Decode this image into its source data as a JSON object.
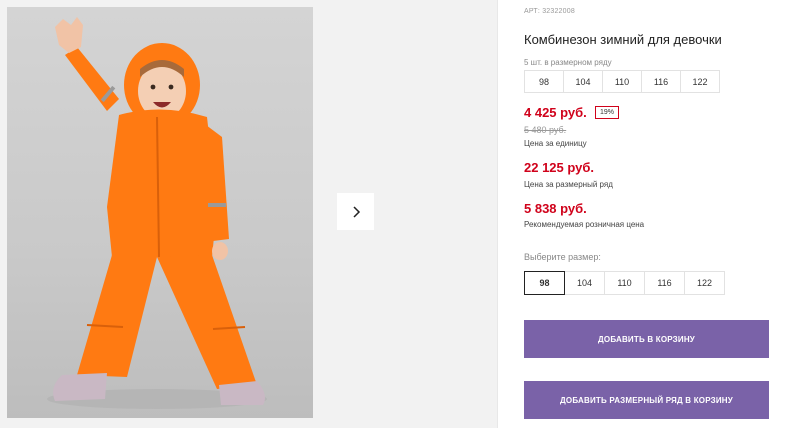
{
  "product": {
    "article": "АРТ: 32322008",
    "title": "Комбинезон зимний для девочки",
    "image_alt": "girl in orange winter jumpsuit"
  },
  "pack": {
    "label": "5 шт. в размерном ряду",
    "sizes": [
      "98",
      "104",
      "110",
      "116",
      "122"
    ]
  },
  "pricing": {
    "unit_price": "4 425 руб.",
    "discount": "19%",
    "old_price": "5 480 руб.",
    "unit_caption": "Цена за единицу",
    "pack_price": "22 125 руб.",
    "pack_caption": "Цена за размерный ряд",
    "retail_price": "5 838 руб.",
    "retail_caption": "Рекомендуемая розничная цена"
  },
  "size_select": {
    "label": "Выберите размер:",
    "sizes": [
      "98",
      "104",
      "110",
      "116",
      "122"
    ],
    "selected": "98"
  },
  "actions": {
    "add_to_cart": "ДОБАВИТЬ В КОРЗИНУ",
    "add_pack_to_cart": "ДОБАВИТЬ РАЗМЕРНЫЙ РЯД В КОРЗИНУ"
  },
  "colors": {
    "price_red": "#d0021b",
    "button_purple": "#7a62a8",
    "suit_orange": "#ff7a12"
  },
  "icons": {
    "gallery_next": "chevron-right-icon"
  }
}
